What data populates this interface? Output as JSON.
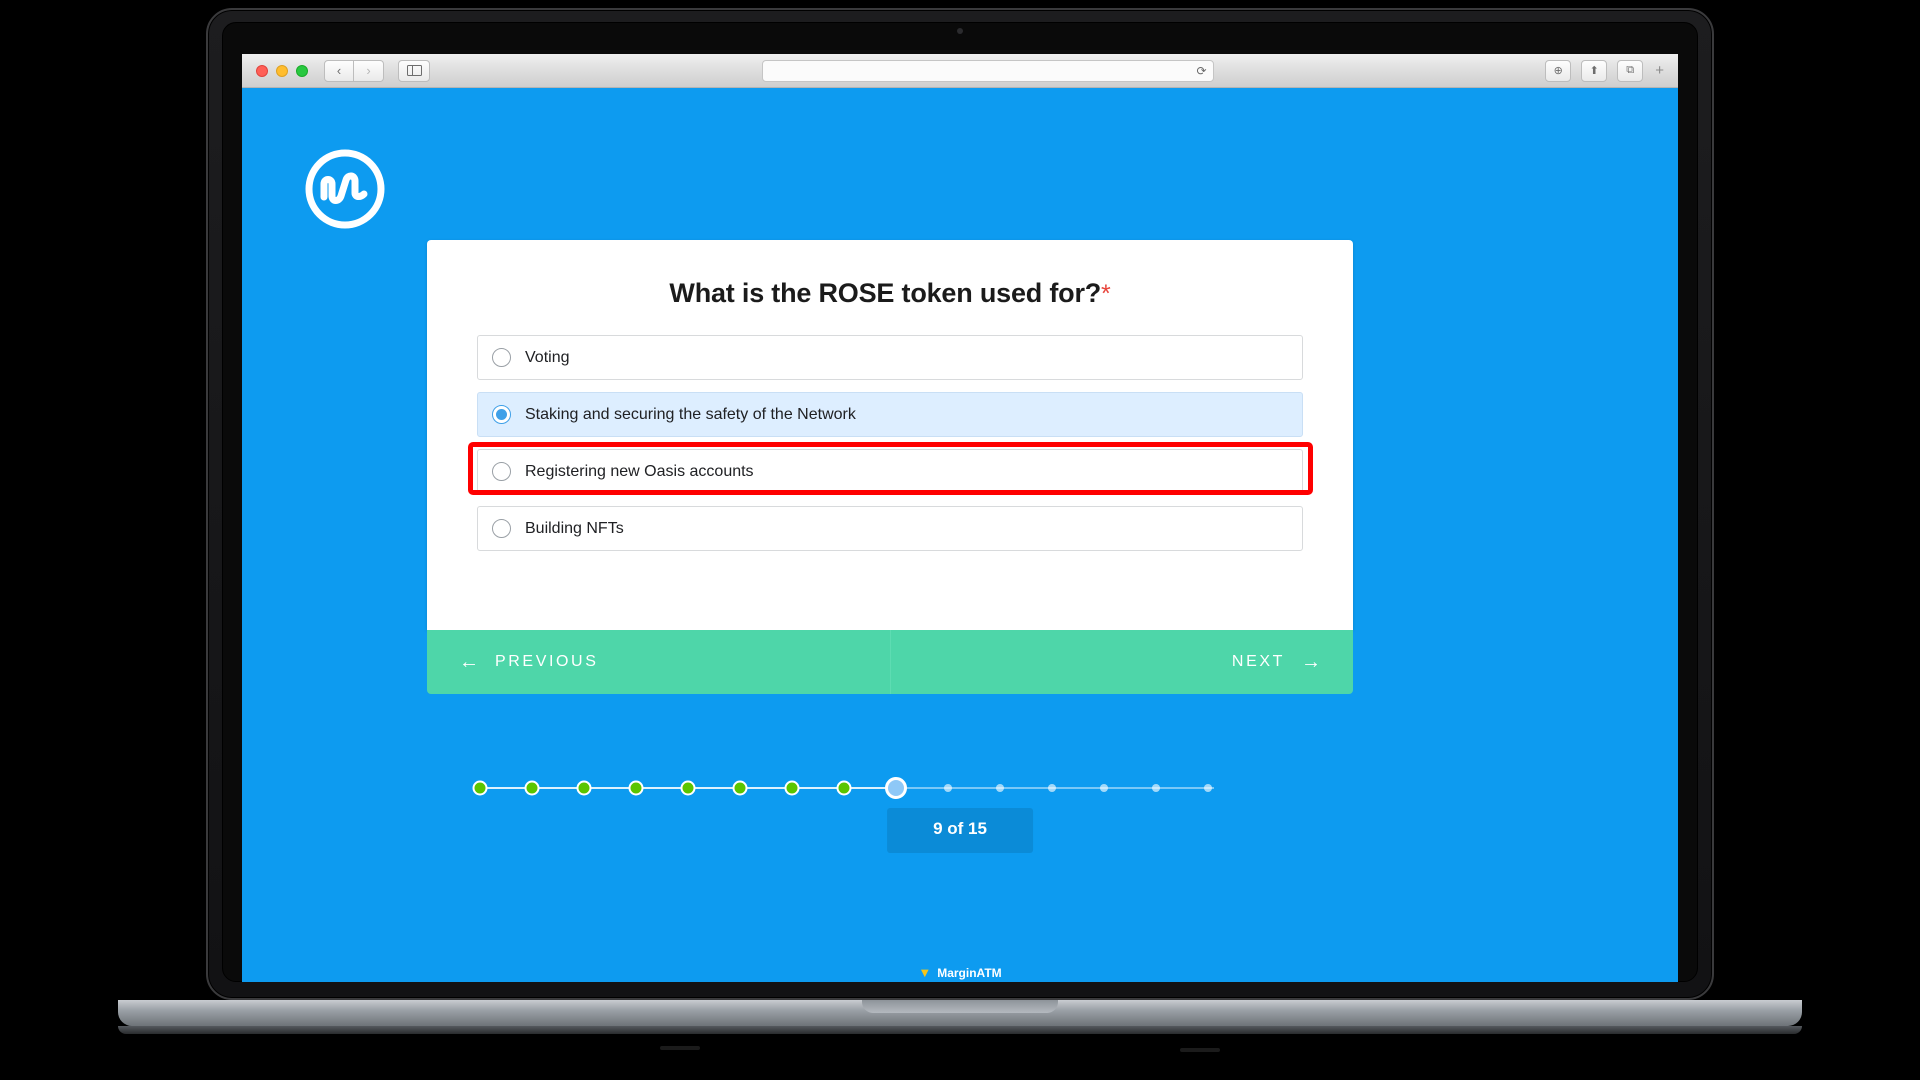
{
  "browser": {
    "traffic_lights": [
      "close",
      "minimize",
      "maximize"
    ],
    "back_label": "‹",
    "forward_label": "›",
    "sidebar_icon": "sidebar-icon",
    "address_value": "",
    "address_placeholder": "",
    "reload_label": "⟳",
    "share_label": "⬆",
    "tabs_label": "⧉",
    "downloads_label": "⊕",
    "new_tab_label": "+"
  },
  "page": {
    "background_color": "#0D9BF0",
    "logo_name": "coinmarketcap-logo"
  },
  "quiz": {
    "question": "What is the ROSE token used for?",
    "required_marker": "*",
    "options": [
      {
        "label": "Voting",
        "selected": false
      },
      {
        "label": "Staking and securing the safety of the Network",
        "selected": true
      },
      {
        "label": "Registering new Oasis accounts",
        "selected": false
      },
      {
        "label": "Building NFTs",
        "selected": false
      }
    ],
    "selected_index": 1,
    "highlight_color": "#ff0000"
  },
  "footer": {
    "previous_label": "PREVIOUS",
    "previous_arrow": "←",
    "next_label": "NEXT",
    "next_arrow": "→",
    "background_color": "#4ed6a9"
  },
  "progress": {
    "current": 9,
    "total": 15,
    "counter_label": "9 of 15",
    "completed_steps": 8,
    "completed_color": "#5bc500",
    "current_color": "#8ec8f7",
    "steps": [
      {
        "state": "done"
      },
      {
        "state": "done"
      },
      {
        "state": "done"
      },
      {
        "state": "done"
      },
      {
        "state": "done"
      },
      {
        "state": "done"
      },
      {
        "state": "done"
      },
      {
        "state": "done"
      },
      {
        "state": "current"
      },
      {
        "state": "todo"
      },
      {
        "state": "todo"
      },
      {
        "state": "todo"
      },
      {
        "state": "todo"
      },
      {
        "state": "todo"
      },
      {
        "state": "todo"
      }
    ]
  },
  "watermark": {
    "mark": "▼",
    "text": "MarginATM"
  }
}
